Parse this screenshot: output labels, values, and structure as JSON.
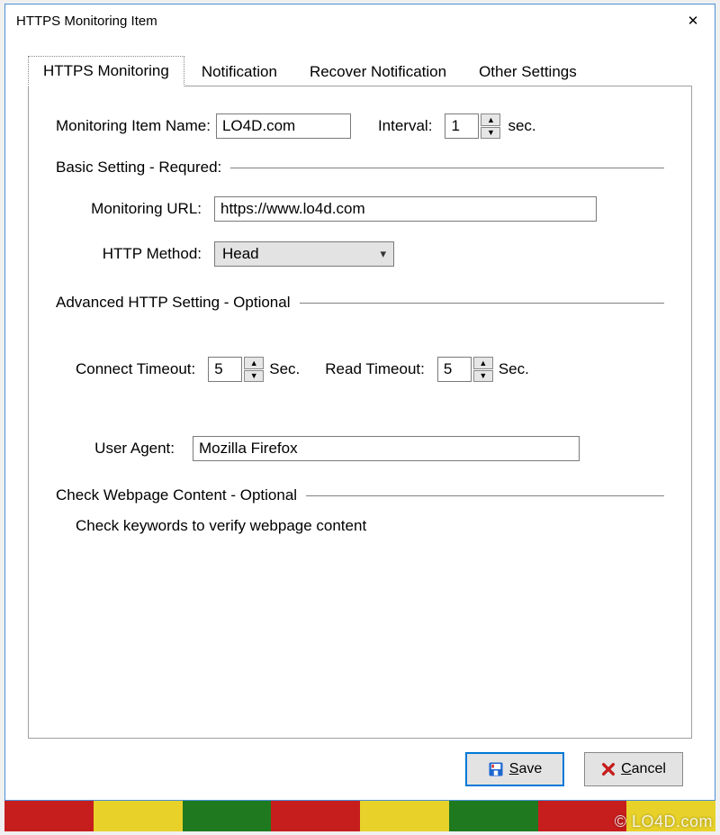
{
  "window": {
    "title": "HTTPS Monitoring Item"
  },
  "tabs": [
    {
      "label": "HTTPS Monitoring"
    },
    {
      "label": "Notification"
    },
    {
      "label": "Recover Notification"
    },
    {
      "label": "Other Settings"
    }
  ],
  "form": {
    "name_label": "Monitoring Item Name:",
    "name_value": "LO4D.com",
    "interval_label": "Interval:",
    "interval_value": "1",
    "interval_unit": "sec.",
    "section_basic": "Basic Setting - Requred:",
    "url_label": "Monitoring URL:",
    "url_value": "https://www.lo4d.com",
    "method_label": "HTTP Method:",
    "method_value": "Head",
    "section_advanced": "Advanced HTTP Setting - Optional",
    "connect_label": "Connect Timeout:",
    "connect_value": "5",
    "connect_unit": "Sec.",
    "read_label": "Read Timeout:",
    "read_value": "5",
    "read_unit": "Sec.",
    "ua_label": "User Agent:",
    "ua_value": "Mozilla Firefox",
    "section_check": "Check Webpage Content - Optional",
    "check_desc": "Check keywords to verify webpage content"
  },
  "buttons": {
    "save": "Save",
    "cancel": "Cancel"
  },
  "watermark": "© LO4D.com"
}
